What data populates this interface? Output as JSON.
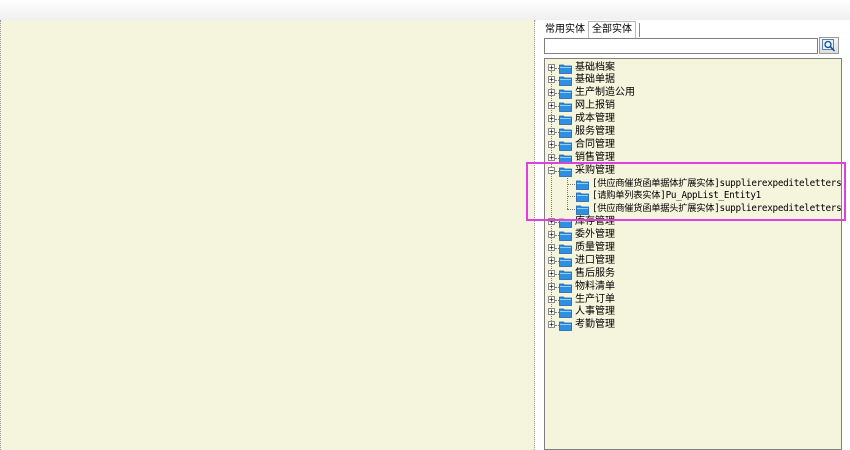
{
  "tabs": [
    {
      "label": "常用实体",
      "active": false
    },
    {
      "label": "全部实体",
      "active": true
    }
  ],
  "search": {
    "value": "",
    "placeholder": ""
  },
  "search_button": {
    "icon": "search-icon"
  },
  "tree": {
    "nodes": [
      {
        "label": "基础档案",
        "expanded": false
      },
      {
        "label": "基础单据",
        "expanded": false
      },
      {
        "label": "生产制造公用",
        "expanded": false
      },
      {
        "label": "网上报销",
        "expanded": false
      },
      {
        "label": "成本管理",
        "expanded": false
      },
      {
        "label": "服务管理",
        "expanded": false
      },
      {
        "label": "合同管理",
        "expanded": false
      },
      {
        "label": "销售管理",
        "expanded": false
      },
      {
        "label": "采购管理",
        "expanded": true,
        "children": [
          {
            "label": "[供应商催货函单据体扩展实体]supplierexpediteletters"
          },
          {
            "label": "[请购单列表实体]Pu_AppList_Entity1"
          },
          {
            "label": "[供应商催货函单据头扩展实体]supplierexpediteletters"
          }
        ]
      },
      {
        "label": "库存管理",
        "expanded": false
      },
      {
        "label": "委外管理",
        "expanded": false
      },
      {
        "label": "质量管理",
        "expanded": false
      },
      {
        "label": "进口管理",
        "expanded": false
      },
      {
        "label": "售后服务",
        "expanded": false
      },
      {
        "label": "物料清单",
        "expanded": false
      },
      {
        "label": "生产订单",
        "expanded": false
      },
      {
        "label": "人事管理",
        "expanded": false
      },
      {
        "label": "考勤管理",
        "expanded": false
      }
    ]
  },
  "colors": {
    "pane_background": "#f5f4dd",
    "folder_blue": "#2f8fe0",
    "highlight_magenta": "#e040e0"
  }
}
